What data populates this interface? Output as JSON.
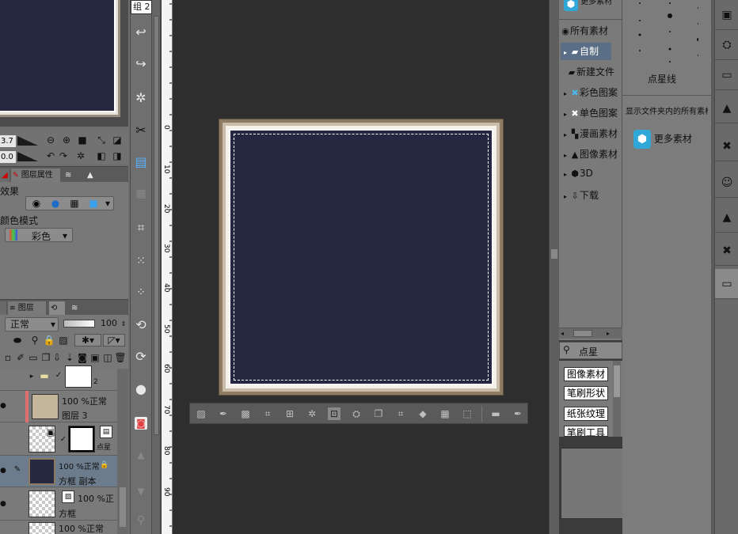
{
  "left_panel": {
    "nav_values": {
      "zoom": "3.7",
      "rotate": "0.0"
    },
    "tabs_top": [
      {
        "label": "图层属性"
      }
    ],
    "layer_property": {
      "effect_label": "效果",
      "color_mode_label": "颜色模式",
      "color_mode_value": "彩色"
    },
    "tabs_bottom": [
      {
        "label": "图层"
      }
    ],
    "layer_panel": {
      "blend_mode": "正常",
      "opacity": "100"
    },
    "layers": [
      {
        "name": "",
        "info": "2"
      },
      {
        "name": "图层 3",
        "info": "100 %正常"
      },
      {
        "name": "",
        "info": "",
        "extra": "点星"
      },
      {
        "name": "方框 副本",
        "info": "100 %正常"
      },
      {
        "name": "方框",
        "info": "100 %正"
      },
      {
        "name": "",
        "info": "100 %正常"
      }
    ]
  },
  "tools": {
    "group_label": "组",
    "group_count": "2"
  },
  "ruler": {
    "ticks": [
      "0",
      "10",
      "20",
      "30",
      "40",
      "50",
      "60",
      "70",
      "80",
      "90"
    ]
  },
  "material_tree": {
    "more_materials": "更多素材",
    "items": [
      {
        "label": "所有素材",
        "icon": "target-icon"
      },
      {
        "label": "自制",
        "icon": "folder-icon",
        "selected": true
      },
      {
        "label": "新建文件",
        "icon": "folder-icon"
      },
      {
        "label": "彩色图案",
        "icon": "color-pattern-icon"
      },
      {
        "label": "单色图案",
        "icon": "mono-pattern-icon"
      },
      {
        "label": "漫画素材",
        "icon": "manga-icon"
      },
      {
        "label": "图像素材",
        "icon": "image-icon"
      },
      {
        "label": "3D",
        "icon": "cube-icon"
      },
      {
        "label": "下载",
        "icon": "download-icon"
      }
    ],
    "search_text": "点星",
    "tags": [
      "图像素材",
      "笔刷形状",
      "纸张纹理",
      "笔刷工具"
    ]
  },
  "material_grid": {
    "item_label": "点星线",
    "show_all_text": "显示文件夹内的所有素材",
    "more_materials": "更多素材"
  },
  "colors": {
    "canvas_bg": "#2e2e2e",
    "frame_navy": "#262741",
    "frame_tan": "#8c7b62",
    "selection": "#5a6e86"
  }
}
